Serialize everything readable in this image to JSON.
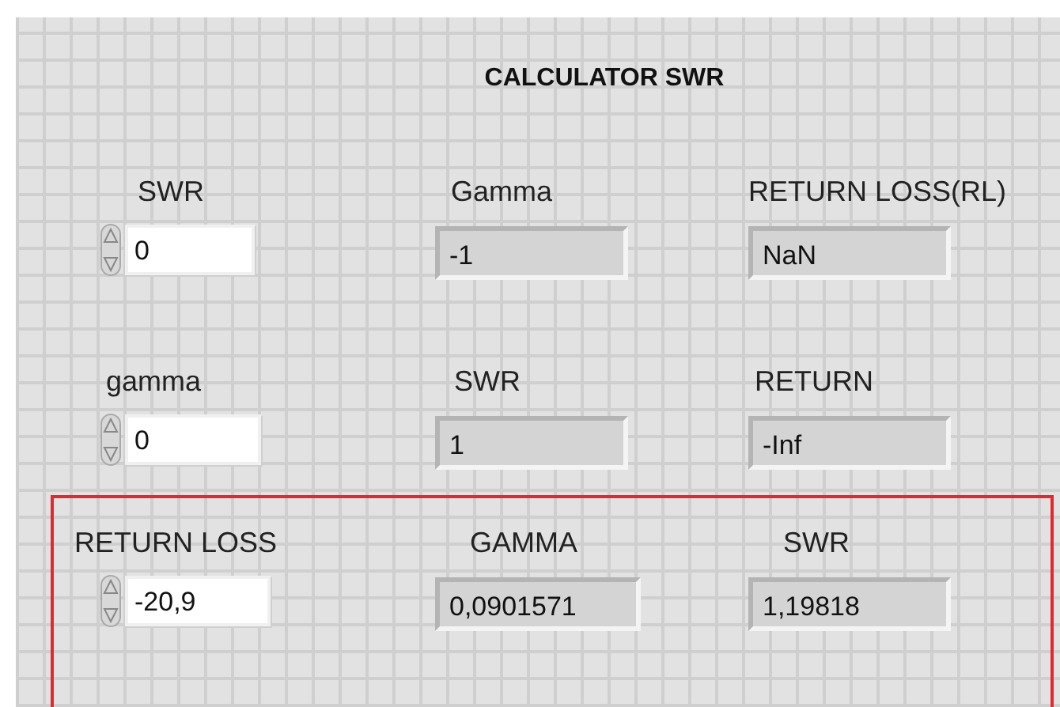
{
  "title": "CALCULATOR SWR",
  "rows": [
    {
      "highlighted": false,
      "cells": [
        {
          "kind": "control",
          "label": "SWR",
          "value": "0"
        },
        {
          "kind": "indicator",
          "label": "Gamma",
          "value": "-1"
        },
        {
          "kind": "indicator",
          "label": "RETURN LOSS(RL)",
          "value": "NaN"
        }
      ]
    },
    {
      "highlighted": false,
      "cells": [
        {
          "kind": "control",
          "label": "gamma",
          "value": "0"
        },
        {
          "kind": "indicator",
          "label": "SWR",
          "value": "1"
        },
        {
          "kind": "indicator",
          "label": "RETURN",
          "value": "-Inf"
        }
      ]
    },
    {
      "highlighted": true,
      "cells": [
        {
          "kind": "control",
          "label": "RETURN LOSS",
          "value": "-20,9"
        },
        {
          "kind": "indicator",
          "label": "GAMMA",
          "value": "0,0901571"
        },
        {
          "kind": "indicator",
          "label": "SWR",
          "value": "1,19818"
        }
      ]
    }
  ]
}
